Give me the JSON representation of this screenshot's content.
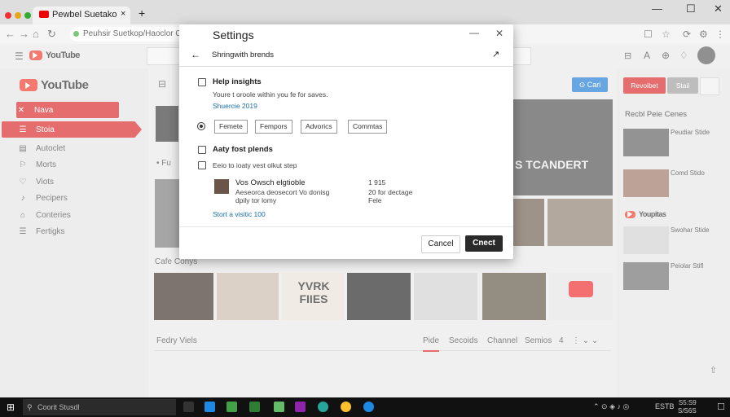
{
  "browser": {
    "tab_title": "Pewbel Suetako",
    "address": "Peuhsir Suetkop/Haoclor Osteliy",
    "tab_close": "×",
    "new_tab": "+",
    "win_min": "—",
    "win_max": "☐",
    "win_close": "✕"
  },
  "youtube": {
    "brand": "YouTube",
    "sidebar": [
      {
        "label": "Nava",
        "icon": "✕",
        "active": "outline"
      },
      {
        "label": "Stoia",
        "icon": "☰",
        "active": "solid"
      },
      {
        "label": "Autoclet",
        "icon": "▤"
      },
      {
        "label": "Morts",
        "icon": "⚐"
      },
      {
        "label": "Viots",
        "icon": "♡"
      },
      {
        "label": "Pecipers",
        "icon": "♪"
      },
      {
        "label": "Conteries",
        "icon": "⌂"
      },
      {
        "label": "Fertigks",
        "icon": "☰"
      }
    ],
    "main_label_1": "Fu",
    "main_thumb_text": "S TCANDERT",
    "section_row": "Cafe Conys",
    "thumb_overlay": "YVRK FIIES",
    "bottom_left": "Fedry Viels",
    "bottom_tabs": [
      "Pide",
      "Secoids",
      "Channel",
      "Semios",
      "4"
    ],
    "header_buttons": [
      "Cari",
      "Revoibet",
      "Stail"
    ],
    "right_title": "Recbl Peie Cenes",
    "right_items": [
      "Peudiar Stide",
      "Comd Stido"
    ],
    "right_section": "Youpitas",
    "right_items_2": [
      "Swohar Stide",
      "Peiolar Stifl"
    ]
  },
  "dialog": {
    "title": "Settings",
    "subtitle": "Shringwith brends",
    "opt1_title": "Help insights",
    "opt1_desc": "Youre t oroole within you fe for saves.",
    "opt1_link": "Shuercie 2019",
    "chips": [
      "Femete",
      "Fempors",
      "Advorics",
      "Commtas"
    ],
    "opt2_title": "Aaty fost plends",
    "opt3_title": "Eeio to ioaty vest olkut step",
    "item_title": "Vos Owsch elgtioble",
    "item_desc1": "Aeseorca deosecort Vo donisg",
    "item_desc2": "dpily tor lomy",
    "item_meta1": "1 915",
    "item_meta2": "20 for dectage",
    "item_meta3": "Fele",
    "link2": "Stort a visitic 100",
    "cancel": "Cancel",
    "confirm": "Cnect"
  },
  "taskbar": {
    "search": "Coorit Stusdl",
    "time": "S5:S9",
    "date": "S/S6S",
    "tray": "ESTB"
  },
  "colors": {
    "accent": "#d82020",
    "link": "#1a6fb0",
    "confirm_btn": "#2a2a2a",
    "blue_btn": "#1877d2"
  }
}
